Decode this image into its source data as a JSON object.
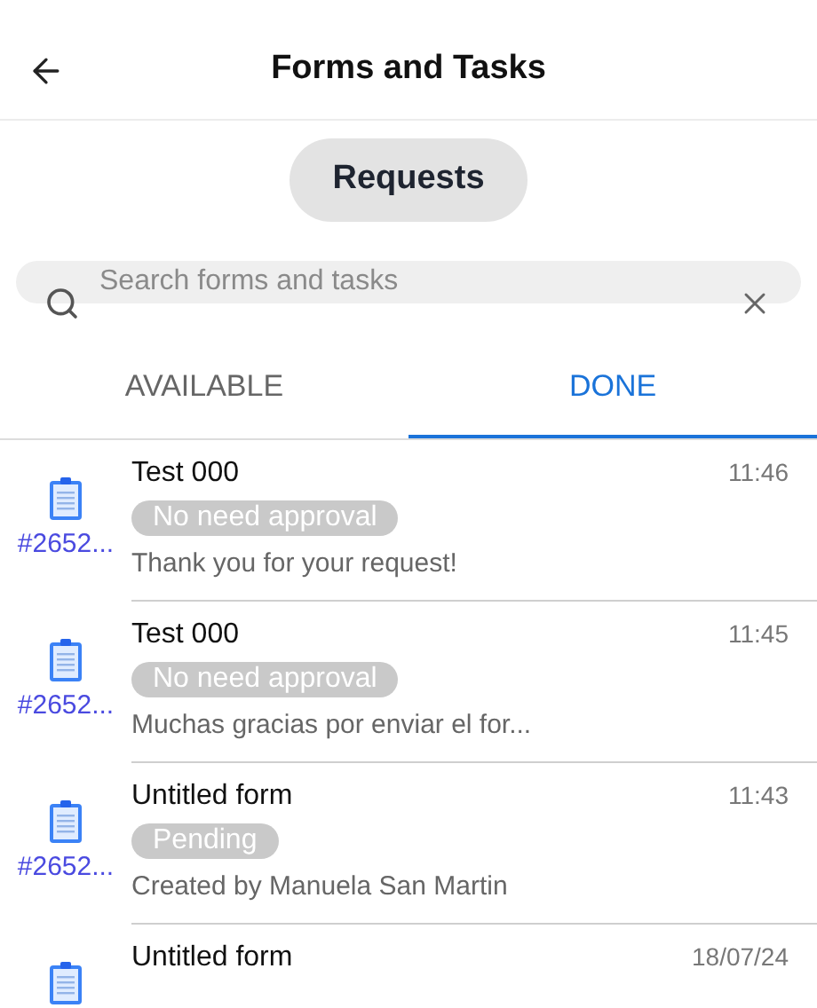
{
  "header": {
    "title": "Forms and Tasks"
  },
  "segment": {
    "label": "Requests",
    "selected": true
  },
  "search": {
    "placeholder": "Search forms and tasks"
  },
  "tabs": [
    {
      "label": "AVAILABLE",
      "selected": false
    },
    {
      "label": "DONE",
      "selected": true
    }
  ],
  "items": [
    {
      "number": "#2652...",
      "title": "Test 000",
      "status": "No need approval",
      "message": "Thank you for your request!",
      "time": "11:46"
    },
    {
      "number": "#2652...",
      "title": "Test 000",
      "status": "No need approval",
      "message": "Muchas gracias por enviar el for...",
      "time": "11:45"
    },
    {
      "number": "#2652...",
      "title": "Untitled form",
      "status": "Pending",
      "message": "Created by Manuela San Martin",
      "time": "11:43"
    },
    {
      "title": "Untitled form",
      "time": "18/07/24"
    }
  ]
}
